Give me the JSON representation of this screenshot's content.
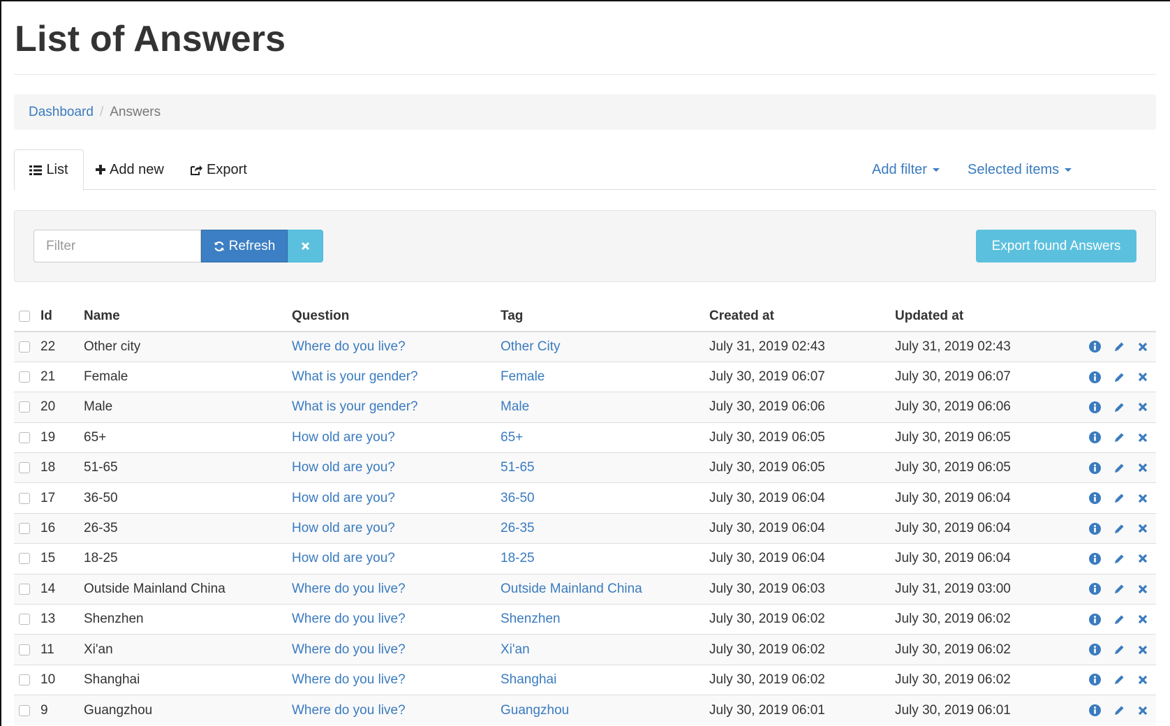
{
  "page": {
    "title": "List of Answers"
  },
  "breadcrumb": {
    "home": "Dashboard",
    "separator": "/",
    "current": "Answers"
  },
  "tabs": [
    {
      "label": "List",
      "icon": "list-icon",
      "active": true
    },
    {
      "label": "Add new",
      "icon": "plus-icon"
    },
    {
      "label": "Export",
      "icon": "share-icon"
    }
  ],
  "dropdowns": {
    "add_filter": "Add filter",
    "selected_items": "Selected items"
  },
  "filter": {
    "placeholder": "Filter",
    "refresh_label": "Refresh",
    "clear_icon": "close-icon",
    "export_label": "Export found Answers"
  },
  "table": {
    "headers": {
      "id": "Id",
      "name": "Name",
      "question": "Question",
      "tag": "Tag",
      "created": "Created at",
      "updated": "Updated at"
    },
    "rows": [
      {
        "id": "22",
        "name": "Other city",
        "question": "Where do you live?",
        "tag": "Other City",
        "created": "July 31, 2019 02:43",
        "updated": "July 31, 2019 02:43"
      },
      {
        "id": "21",
        "name": "Female",
        "question": "What is your gender?",
        "tag": "Female",
        "created": "July 30, 2019 06:07",
        "updated": "July 30, 2019 06:07"
      },
      {
        "id": "20",
        "name": "Male",
        "question": "What is your gender?",
        "tag": "Male",
        "created": "July 30, 2019 06:06",
        "updated": "July 30, 2019 06:06"
      },
      {
        "id": "19",
        "name": "65+",
        "question": "How old are you?",
        "tag": "65+",
        "created": "July 30, 2019 06:05",
        "updated": "July 30, 2019 06:05"
      },
      {
        "id": "18",
        "name": "51-65",
        "question": "How old are you?",
        "tag": "51-65",
        "created": "July 30, 2019 06:05",
        "updated": "July 30, 2019 06:05"
      },
      {
        "id": "17",
        "name": "36-50",
        "question": "How old are you?",
        "tag": "36-50",
        "created": "July 30, 2019 06:04",
        "updated": "July 30, 2019 06:04"
      },
      {
        "id": "16",
        "name": "26-35",
        "question": "How old are you?",
        "tag": "26-35",
        "created": "July 30, 2019 06:04",
        "updated": "July 30, 2019 06:04"
      },
      {
        "id": "15",
        "name": "18-25",
        "question": "How old are you?",
        "tag": "18-25",
        "created": "July 30, 2019 06:04",
        "updated": "July 30, 2019 06:04"
      },
      {
        "id": "14",
        "name": "Outside Mainland China",
        "question": "Where do you live?",
        "tag": "Outside Mainland China",
        "created": "July 30, 2019 06:03",
        "updated": "July 31, 2019 03:00"
      },
      {
        "id": "13",
        "name": "Shenzhen",
        "question": "Where do you live?",
        "tag": "Shenzhen",
        "created": "July 30, 2019 06:02",
        "updated": "July 30, 2019 06:02"
      },
      {
        "id": "11",
        "name": "Xi'an",
        "question": "Where do you live?",
        "tag": "Xi'an",
        "created": "July 30, 2019 06:02",
        "updated": "July 30, 2019 06:02"
      },
      {
        "id": "10",
        "name": "Shanghai",
        "question": "Where do you live?",
        "tag": "Shanghai",
        "created": "July 30, 2019 06:02",
        "updated": "July 30, 2019 06:02"
      },
      {
        "id": "9",
        "name": "Guangzhou",
        "question": "Where do you live?",
        "tag": "Guangzhou",
        "created": "July 30, 2019 06:01",
        "updated": "July 30, 2019 06:01"
      }
    ],
    "row_actions": [
      "info-icon",
      "pencil-icon",
      "delete-icon"
    ]
  },
  "colors": {
    "link": "#3a7bbf",
    "primary": "#3d7fc4",
    "info": "#5bc0de"
  }
}
